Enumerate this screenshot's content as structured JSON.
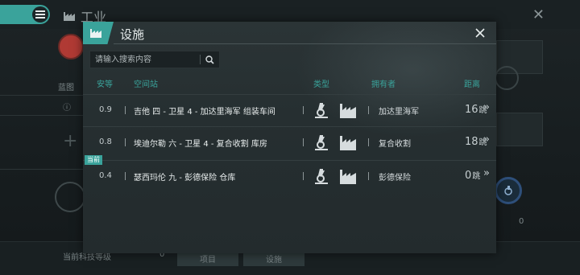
{
  "background": {
    "window_title": "工业",
    "left_label": "蓝图",
    "bottom_label": "当前科技等级",
    "bottom_value": "0",
    "bottom_btn1": "项目",
    "bottom_btn2": "设施",
    "right_value": "0"
  },
  "dialog": {
    "title": "设施",
    "search_placeholder": "请输入搜索内容",
    "columns": {
      "security": "安等",
      "station": "空间站",
      "type": "类型",
      "owner": "拥有者",
      "distance": "距离"
    },
    "rows": [
      {
        "security": "0.9",
        "station": "吉他 四 - 卫星 4 - 加达里海军 组装车间",
        "owner": "加达里海军",
        "jumps": "16",
        "jump_unit": "跳",
        "badge": ""
      },
      {
        "security": "0.8",
        "station": "埃迪尔勒 六 - 卫星 4 - 复合收割 库房",
        "owner": "复合收割",
        "jumps": "18",
        "jump_unit": "跳",
        "badge": ""
      },
      {
        "security": "0.4",
        "station": "瑟西玛伦 九 - 彭德保险 仓库",
        "owner": "彭德保险",
        "jumps": "0",
        "jump_unit": "跳",
        "badge": "当前"
      }
    ]
  },
  "icons": {
    "menu": "menu-icon",
    "factory": "factory-icon",
    "close": "close-icon",
    "search": "search-icon",
    "research": "microscope-icon",
    "manufacture": "factory-icon",
    "arrow": "double-chevron-right-icon"
  },
  "colors": {
    "accent": "#3aa39b",
    "dialog_bg": "#262f31",
    "header_text": "#3aa39b"
  }
}
